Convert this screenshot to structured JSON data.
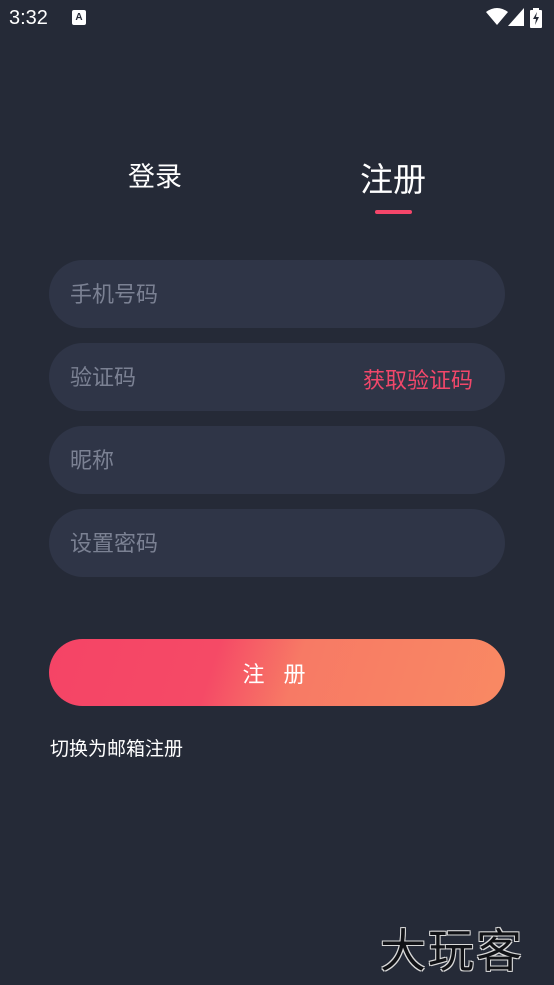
{
  "status_bar": {
    "time": "3:32",
    "notification_icon_letter": "A",
    "icons": [
      "wifi-icon",
      "signal-icon",
      "battery-charging-icon"
    ]
  },
  "tabs": {
    "login_label": "登录",
    "register_label": "注册",
    "active": "register",
    "accent_color": "#f5466a"
  },
  "form": {
    "phone_placeholder": "手机号码",
    "code_placeholder": "验证码",
    "get_code_label": "获取验证码",
    "nickname_placeholder": "昵称",
    "password_placeholder": "设置密码"
  },
  "submit_label": "注 册",
  "switch_link_label": "切换为邮箱注册",
  "watermark_text": "大玩客",
  "colors": {
    "background": "#252a37",
    "field_background": "#2f3547",
    "gradient_start": "#f54466",
    "gradient_end": "#f98963"
  }
}
